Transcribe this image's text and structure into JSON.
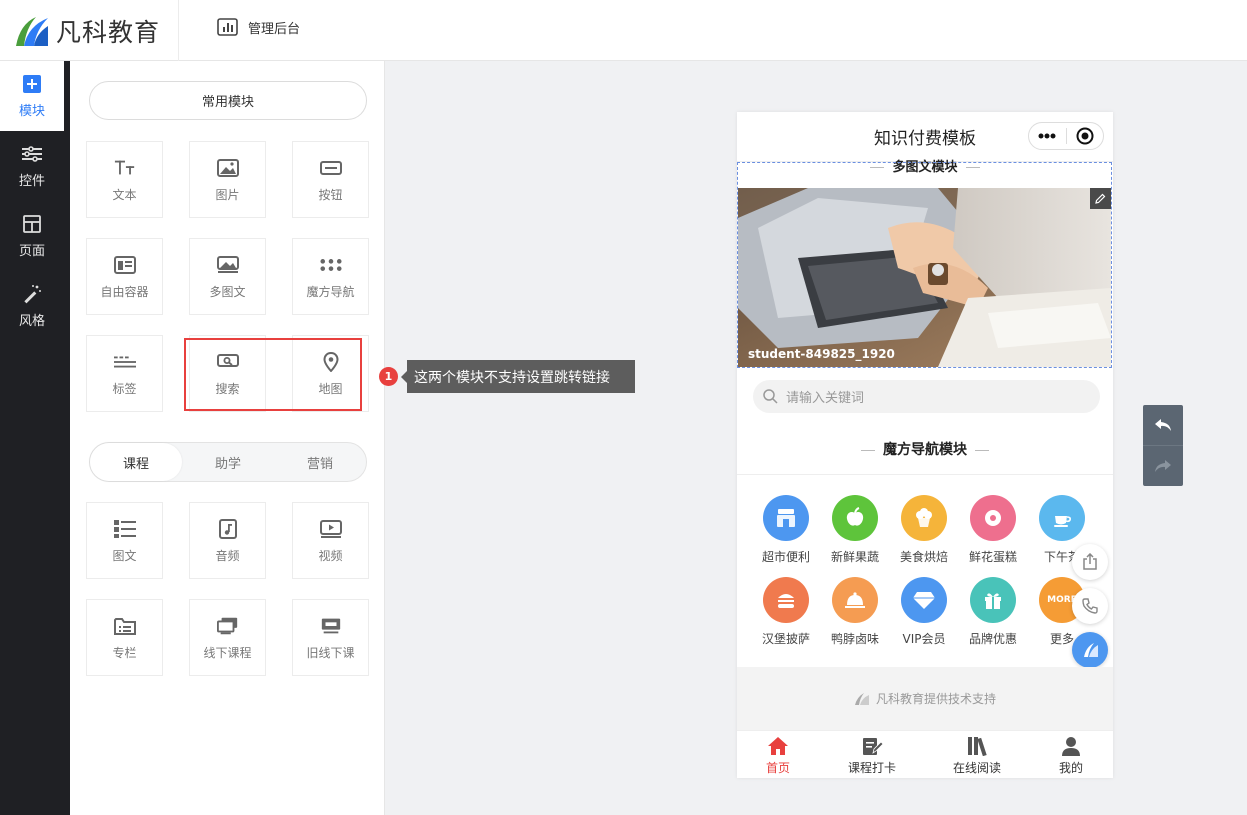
{
  "header": {
    "brand_name": "凡科教育",
    "admin_label": "管理后台"
  },
  "leftnav": {
    "items": [
      {
        "label": "模块",
        "icon": "plus-square-icon"
      },
      {
        "label": "控件",
        "icon": "sliders-icon"
      },
      {
        "label": "页面",
        "icon": "layout-icon"
      },
      {
        "label": "风格",
        "icon": "magic-wand-icon"
      }
    ]
  },
  "panel": {
    "common_label": "常用模块",
    "tiles_row1": [
      {
        "label": "文本"
      },
      {
        "label": "图片"
      },
      {
        "label": "按钮"
      }
    ],
    "tiles_row2": [
      {
        "label": "自由容器"
      },
      {
        "label": "多图文"
      },
      {
        "label": "魔方导航"
      }
    ],
    "tiles_row3": [
      {
        "label": "标签"
      },
      {
        "label": "搜索"
      },
      {
        "label": "地图"
      }
    ],
    "segments": [
      "课程",
      "助学",
      "营销"
    ],
    "tiles_row4": [
      {
        "label": "图文"
      },
      {
        "label": "音频"
      },
      {
        "label": "视频"
      }
    ],
    "tiles_row5": [
      {
        "label": "专栏"
      },
      {
        "label": "线下课程"
      },
      {
        "label": "旧线下课"
      }
    ]
  },
  "tooltip": {
    "badge": "1",
    "text": "这两个模块不支持设置跳转链接"
  },
  "phone": {
    "title": "知识付费模板",
    "cut_section_title": "多图文模块",
    "photo_caption": "student-849825_1920",
    "search_placeholder": "请输入关键词",
    "nav_section_title": "魔方导航模块",
    "nav_items": [
      {
        "label": "超市便利",
        "color": "#4d97f0"
      },
      {
        "label": "新鲜果蔬",
        "color": "#5ec43b"
      },
      {
        "label": "美食烘焙",
        "color": "#f5b43a"
      },
      {
        "label": "鲜花蛋糕",
        "color": "#ee6f8e"
      },
      {
        "label": "下午茶",
        "color": "#5bb8ee"
      },
      {
        "label": "汉堡披萨",
        "color": "#f07a4e"
      },
      {
        "label": "鸭脖卤味",
        "color": "#f59c52"
      },
      {
        "label": "VIP会员",
        "color": "#4d97f0"
      },
      {
        "label": "品牌优惠",
        "color": "#49c3b9"
      },
      {
        "label": "更多",
        "color": "#f59c35",
        "badge": "MORE"
      }
    ],
    "support_text": "凡科教育提供技术支持",
    "tabs": [
      {
        "label": "首页"
      },
      {
        "label": "课程打卡"
      },
      {
        "label": "在线阅读"
      },
      {
        "label": "我的"
      }
    ]
  },
  "colors": {
    "accent": "#2e7cf6",
    "danger": "#e8403e",
    "nav_bg": "#1f2024"
  }
}
